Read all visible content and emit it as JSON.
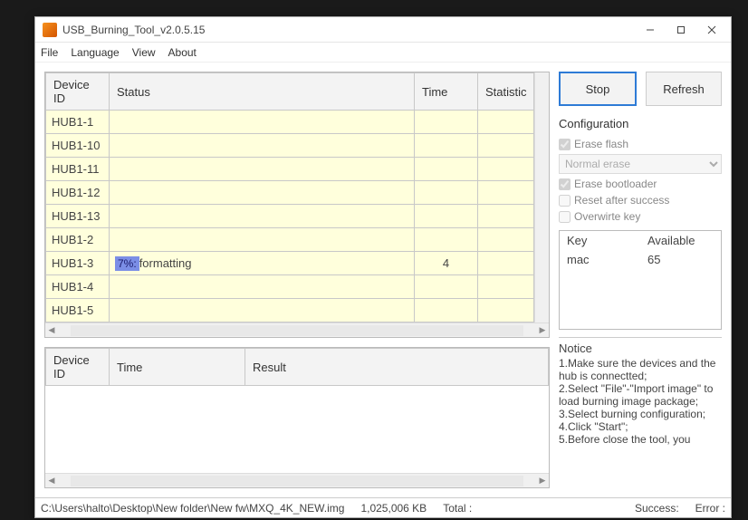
{
  "window": {
    "title": "USB_Burning_Tool_v2.0.5.15"
  },
  "menu": {
    "file": "File",
    "language": "Language",
    "view": "View",
    "about": "About"
  },
  "columns": {
    "device_id": "Device ID",
    "status": "Status",
    "time": "Time",
    "statistic": "Statistic",
    "result": "Result"
  },
  "devices": [
    {
      "id": "HUB1-1",
      "status": "",
      "time": "",
      "stat": ""
    },
    {
      "id": "HUB1-10",
      "status": "",
      "time": "",
      "stat": ""
    },
    {
      "id": "HUB1-11",
      "status": "",
      "time": "",
      "stat": ""
    },
    {
      "id": "HUB1-12",
      "status": "",
      "time": "",
      "stat": ""
    },
    {
      "id": "HUB1-13",
      "status": "",
      "time": "",
      "stat": ""
    },
    {
      "id": "HUB1-2",
      "status": "",
      "time": "",
      "stat": ""
    },
    {
      "id": "HUB1-3",
      "status": "formatting",
      "pct": "7%:",
      "time": "4",
      "stat": ""
    },
    {
      "id": "HUB1-4",
      "status": "",
      "time": "",
      "stat": ""
    },
    {
      "id": "HUB1-5",
      "status": "",
      "time": "",
      "stat": ""
    }
  ],
  "buttons": {
    "stop": "Stop",
    "refresh": "Refresh"
  },
  "config": {
    "title": "Configuration",
    "erase_flash": "Erase flash",
    "erase_mode": "Normal erase",
    "erase_bootloader": "Erase bootloader",
    "reset_after": "Reset after success",
    "overwrite_key": "Overwirte key"
  },
  "key_table": {
    "h_key": "Key",
    "h_avail": "Available",
    "r0_key": "mac",
    "r0_avail": "65"
  },
  "notice": {
    "title": "Notice",
    "lines": "1.Make sure the devices and the hub is connectted;\n2.Select \"File\"-\"Import image\" to load burning image package;\n3.Select burning configuration;\n4.Click \"Start\";\n5.Before close the tool, you"
  },
  "statusbar": {
    "path": "C:\\Users\\halto\\Desktop\\New folder\\New fw\\MXQ_4K_NEW.img",
    "size": "1,025,006 KB",
    "total": "Total :",
    "success": "Success:",
    "error": "Error :"
  }
}
